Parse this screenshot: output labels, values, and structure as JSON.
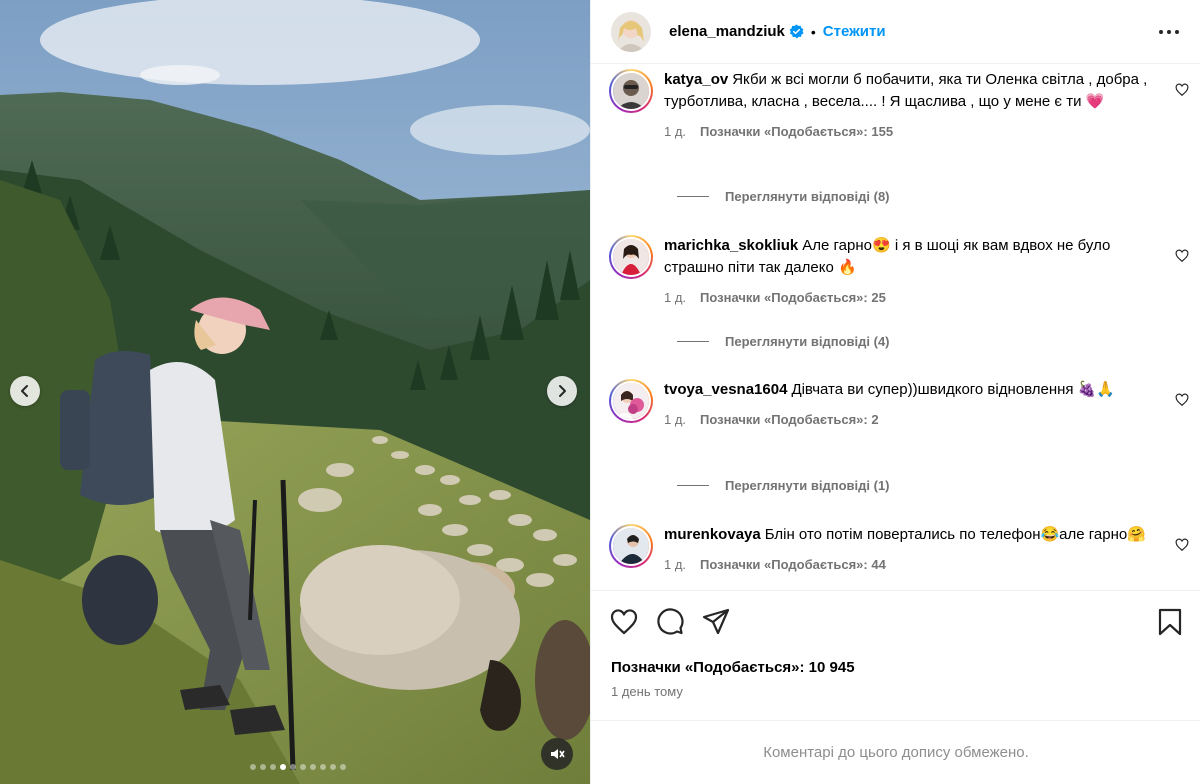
{
  "post": {
    "author": "elena_mandziuk",
    "follow_label": "Стежити",
    "separator": "•",
    "verified_icon": "verified-badge-icon",
    "more_icon": "more-horizontal-icon",
    "likes_label": "Позначки «Подобається»: 10 945",
    "time_ago": "1 день тому",
    "comments_limited": "Коментарі до цього допису обмежено."
  },
  "media": {
    "prev_icon": "chevron-left-icon",
    "next_icon": "chevron-right-icon",
    "mute_icon": "audio-muted-icon",
    "slide_count": 10,
    "active_slide": 3
  },
  "comments": [
    {
      "user": "katya_ov",
      "text": "Якби ж всі могли б побачити, яка ти Оленка світла , добра , турботлива, класна , весела.... ! Я щаслива , що у мене є ти 💗",
      "age": "1 д.",
      "likes": "Позначки «Подобається»: 155",
      "replies": "Переглянути відповіді (8)"
    },
    {
      "user": "marichka_skokliuk",
      "text": "Але гарно😍 і я в шоці як вам вдвох не було страшно піти так далеко 🔥",
      "age": "1 д.",
      "likes": "Позначки «Подобається»: 25",
      "replies": "Переглянути відповіді (4)"
    },
    {
      "user": "tvoya_vesna1604",
      "text": "Дівчата ви супер))швидкого відновлення 🍇🙏",
      "age": "1 д.",
      "likes": "Позначки «Подобається»: 2",
      "replies": "Переглянути відповіді (1)"
    },
    {
      "user": "murenkovaya",
      "text": "Блін ото потім повертались по телефон😂але гарно🤗",
      "age": "1 д.",
      "likes": "Позначки «Подобається»: 44",
      "replies": ""
    }
  ],
  "actions": {
    "like_icon": "heart-icon",
    "comment_icon": "comment-icon",
    "share_icon": "share-icon",
    "save_icon": "bookmark-icon"
  }
}
